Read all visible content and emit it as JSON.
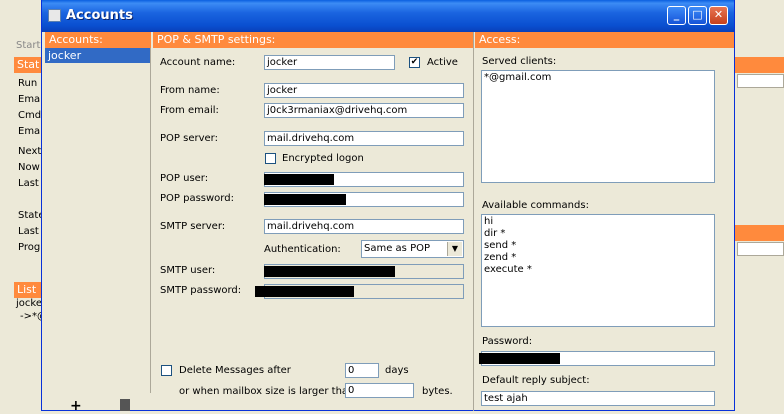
{
  "background": {
    "toolbar_label": "Start",
    "status_header": "Stat",
    "status_lines": [
      "Run",
      "Ema",
      "Cmd",
      "Ema"
    ],
    "time_lines": [
      "Next",
      "Now",
      "Last"
    ],
    "state_lines": [
      "State",
      "Last",
      "Prog"
    ],
    "list_header": "List",
    "list_lines": [
      "jocke",
      "->*@"
    ]
  },
  "dialog": {
    "title": "Accounts",
    "accounts": {
      "header": "Accounts:",
      "items": [
        "jocker"
      ],
      "add_icon": "+",
      "delete_icon": "trash-icon"
    },
    "settings": {
      "header": "POP & SMTP settings:",
      "account_name_label": "Account name:",
      "account_name": "jocker",
      "active_label": "Active",
      "active_checked": "✔",
      "from_name_label": "From name:",
      "from_name": "jocker",
      "from_email_label": "From email:",
      "from_email": "j0ck3rmaniax@drivehq.com",
      "pop_server_label": "POP server:",
      "pop_server": "mail.drivehq.com",
      "encrypted_label": "Encrypted logon",
      "pop_user_label": "POP user:",
      "pop_password_label": "POP password:",
      "smtp_server_label": "SMTP server:",
      "smtp_server": "mail.drivehq.com",
      "auth_label": "Authentication:",
      "auth_value": "Same as POP",
      "smtp_user_label": "SMTP user:",
      "smtp_password_label": "SMTP password:",
      "delete_label": "Delete Messages after",
      "days_value": "0",
      "days_label": "days",
      "mailbox_label": "or when mailbox size is larger than",
      "bytes_value": "0",
      "bytes_label": "bytes."
    },
    "access": {
      "header": "Access:",
      "served_label": "Served clients:",
      "served_clients": [
        "*@gmail.com"
      ],
      "commands_label": "Available commands:",
      "commands": [
        "hi",
        "dir *",
        "send *",
        "zend *",
        "execute *"
      ],
      "password_label": "Password:",
      "reply_label": "Default reply subject:",
      "reply_subject": "test ajah"
    }
  }
}
